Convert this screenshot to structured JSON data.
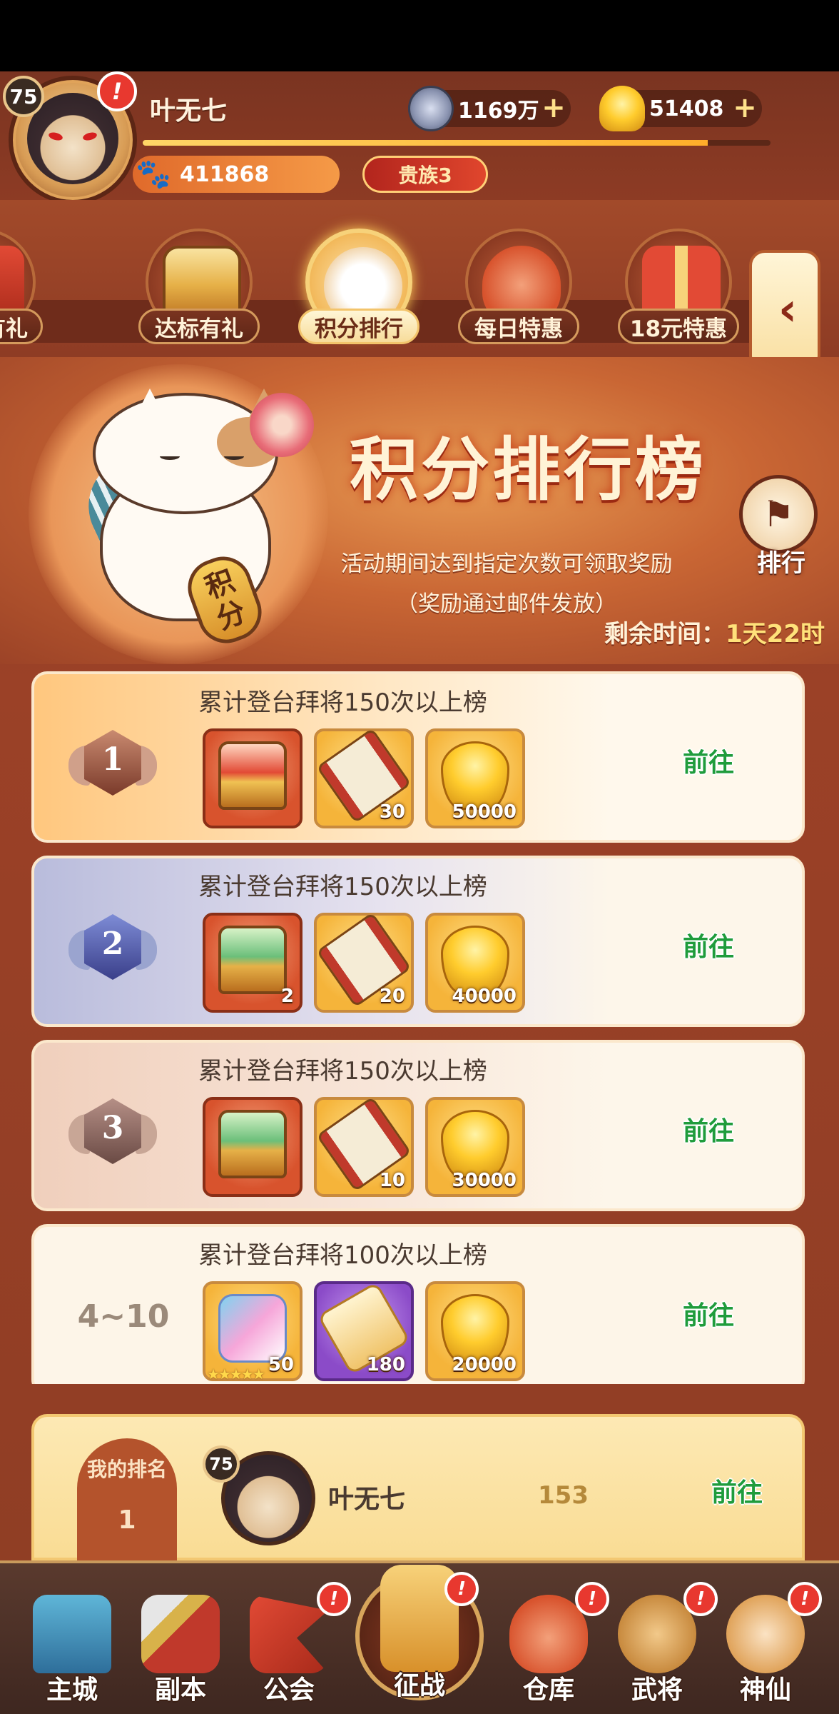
{
  "player": {
    "level": "75",
    "name": "叶无七",
    "power": "411868",
    "noble": "贵族3",
    "xp_progress": 0.9
  },
  "currencies": {
    "coins": "1169万",
    "gold": "51408"
  },
  "tabs": [
    {
      "label": "登录有礼",
      "visible_label": "录有礼"
    },
    {
      "label": "达标有礼"
    },
    {
      "label": "积分排行",
      "active": true
    },
    {
      "label": "每日特惠"
    },
    {
      "label": "18元特惠"
    }
  ],
  "banner": {
    "title": "积分排行榜",
    "sign_text": "积分",
    "desc_line1": "活动期间达到指定次数可领取奖励",
    "desc_line2": "（奖励通过邮件发放）",
    "remaining_label": "剩余时间：",
    "remaining_value": "1天22时",
    "rank_button": "排行"
  },
  "ranks": [
    {
      "rank": "1",
      "condition": "累计登台拜将150次以上榜",
      "rewards": [
        {
          "icon": "red-treasure-chest-icon",
          "qty": ""
        },
        {
          "icon": "recruit-scroll-icon",
          "qty": "30"
        },
        {
          "icon": "gold-ingot-icon",
          "qty": "50000"
        }
      ],
      "action": "前往"
    },
    {
      "rank": "2",
      "condition": "累计登台拜将150次以上榜",
      "rewards": [
        {
          "icon": "jade-treasure-chest-icon",
          "qty": "2"
        },
        {
          "icon": "recruit-scroll-icon",
          "qty": "20"
        },
        {
          "icon": "gold-ingot-icon",
          "qty": "40000"
        }
      ],
      "action": "前往"
    },
    {
      "rank": "3",
      "condition": "累计登台拜将150次以上榜",
      "rewards": [
        {
          "icon": "jade-treasure-chest-icon",
          "qty": ""
        },
        {
          "icon": "recruit-scroll-icon",
          "qty": "10"
        },
        {
          "icon": "gold-ingot-icon",
          "qty": "30000"
        }
      ],
      "action": "前往"
    },
    {
      "rank": "4~10",
      "condition": "累计登台拜将100次以上榜",
      "rewards": [
        {
          "icon": "hero-shard-puzzle-icon",
          "qty": "50",
          "stars": "★★★★★"
        },
        {
          "icon": "purple-letter-icon",
          "qty": "180"
        },
        {
          "icon": "gold-ingot-icon",
          "qty": "20000"
        }
      ],
      "action": "前往"
    }
  ],
  "my_rank": {
    "title": "我的排名",
    "value": "1",
    "level": "75",
    "name": "叶无七",
    "score": "153",
    "action": "前往"
  },
  "nav": [
    {
      "label": "主城",
      "icon": "main-city-icon",
      "alert": false
    },
    {
      "label": "副本",
      "icon": "dungeon-sword-icon",
      "alert": false
    },
    {
      "label": "公会",
      "icon": "guild-flag-icon",
      "alert": true
    },
    {
      "label": "征战",
      "icon": "battle-helmet-icon",
      "alert": true
    },
    {
      "label": "仓库",
      "icon": "warehouse-bag-icon",
      "alert": true
    },
    {
      "label": "武将",
      "icon": "general-cat-icon",
      "alert": true
    },
    {
      "label": "神仙",
      "icon": "immortal-cat-icon",
      "alert": true
    }
  ],
  "colors": {
    "accent_gold": "#ffd667",
    "go_green": "#1f9c3c",
    "alert_red": "#e8382f",
    "background": "#8e3d24"
  }
}
